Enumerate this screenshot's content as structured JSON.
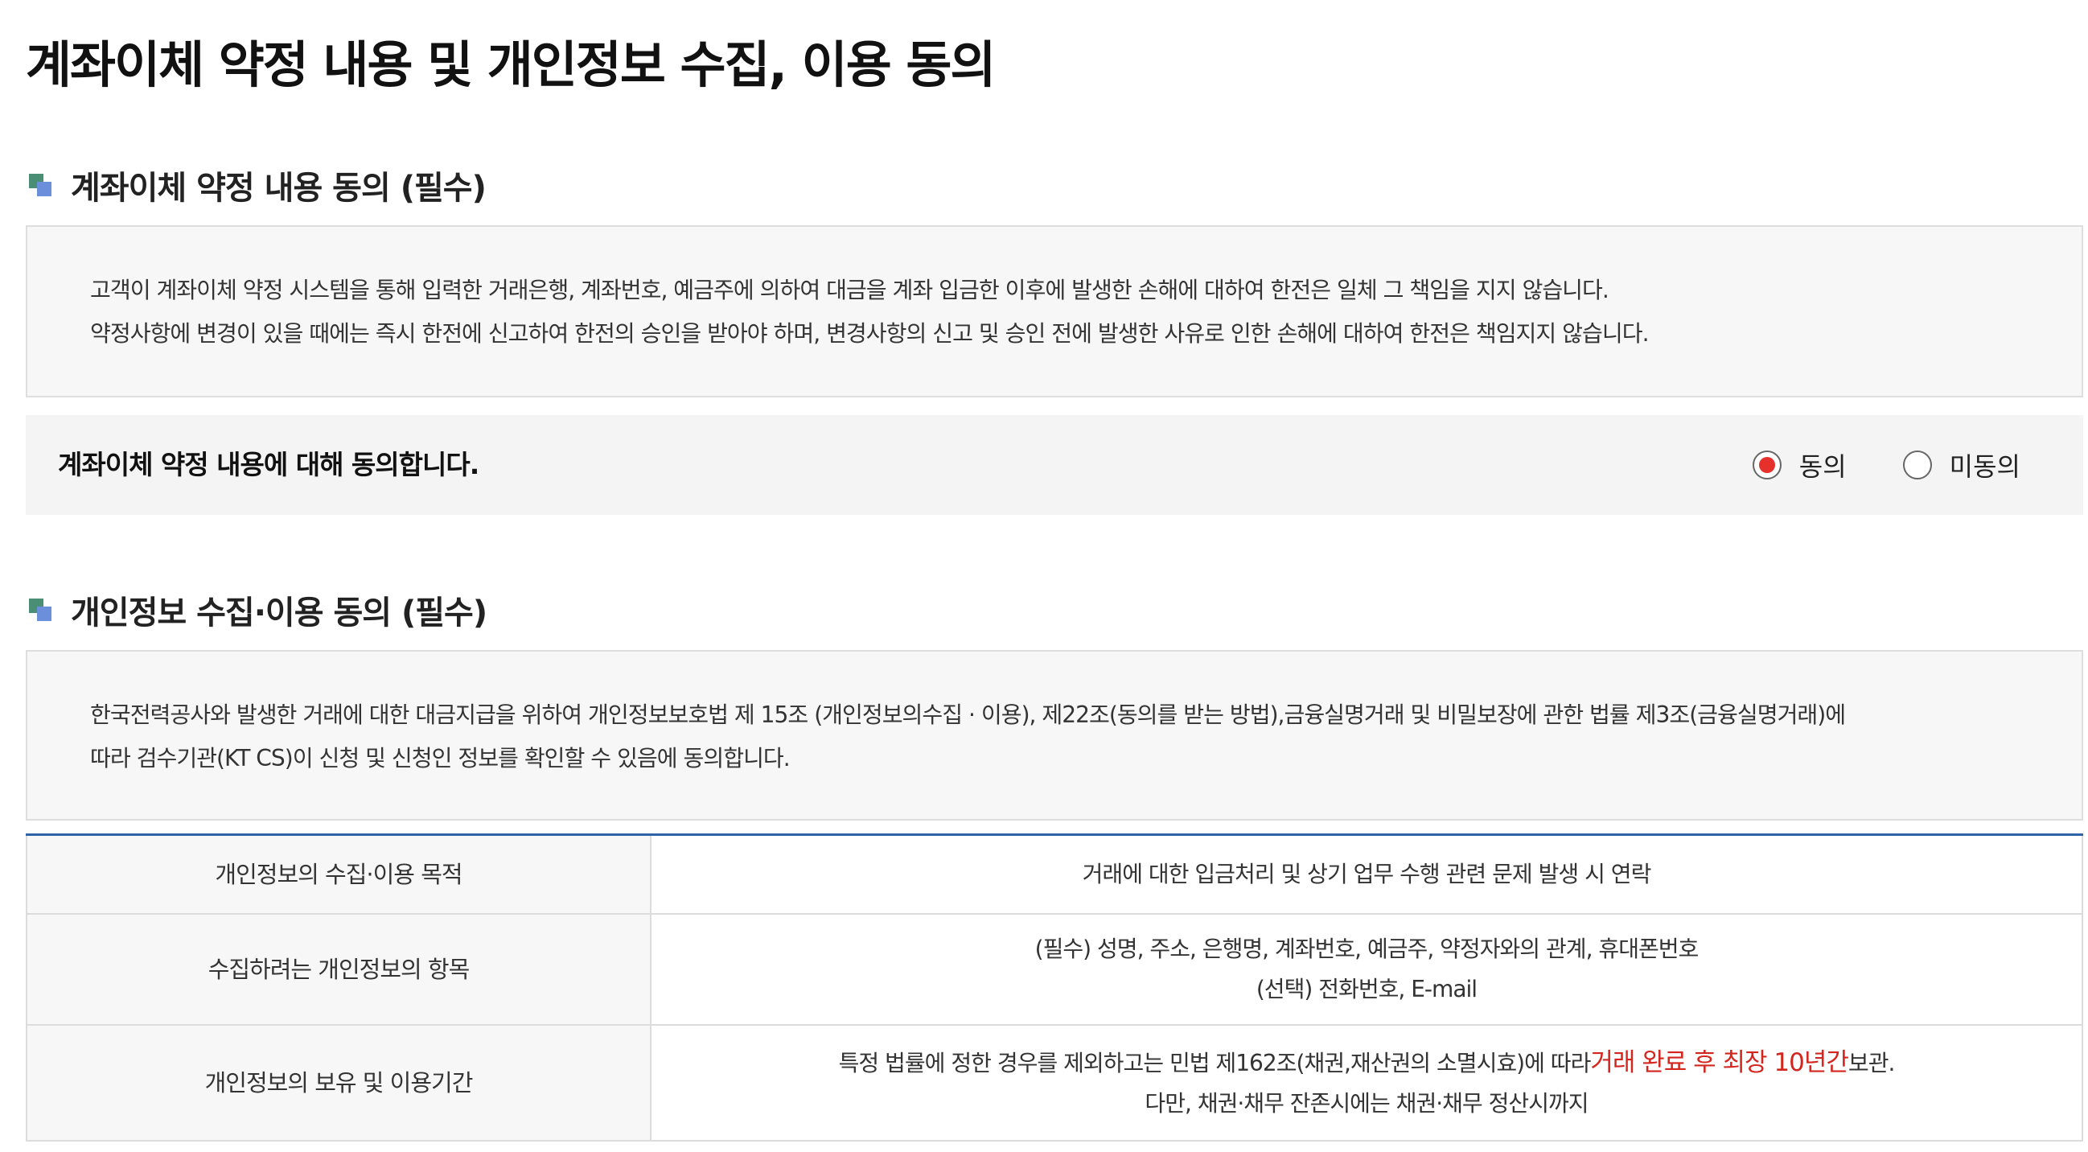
{
  "page_title": "계좌이체 약정 내용 및 개인정보 수집, 이용 동의",
  "section1": {
    "title": "계좌이체 약정 내용 동의 (필수)",
    "lines": [
      "고객이 계좌이체 약정 시스템을 통해 입력한 거래은행, 계좌번호, 예금주에 의하여 대금을 계좌 입금한 이후에 발생한 손해에 대하여 한전은 일체 그 책임을 지지 않습니다.",
      "약정사항에 변경이 있을 때에는 즉시 한전에 신고하여 한전의 승인을 받아야 하며, 변경사항의 신고 및 승인 전에 발생한 사유로 인한 손해에 대하여 한전은 책임지지 않습니다."
    ],
    "agree_question": "계좌이체 약정 내용에 대해 동의합니다.",
    "options": {
      "agree": "동의",
      "disagree": "미동의"
    },
    "selected": "agree"
  },
  "section2": {
    "title": "개인정보 수집·이용 동의 (필수)",
    "lines": [
      "한국전력공사와 발생한 거래에 대한 대금지급을 위하여 개인정보보호법 제 15조 (개인정보의수집 · 이용), 제22조(동의를 받는 방법),금융실명거래 및 비밀보장에 관한 법률 제3조(금융실명거래)에",
      "따라 검수기관(KT CS)이 신청 및 신청인 정보를 확인할 수 있음에 동의합니다."
    ],
    "table": {
      "rows": [
        {
          "header": "개인정보의 수집·이용 목적",
          "value_line1": "거래에 대한 입금처리 및 상기 업무 수행 관련 문제 발생 시 연락"
        },
        {
          "header": "수집하려는 개인정보의 항목",
          "value_line1": "(필수) 성명, 주소, 은행명, 계좌번호, 예금주, 약정자와의 관계, 휴대폰번호",
          "value_line2": "(선택) 전화번호, E-mail"
        },
        {
          "header": "개인정보의 보유 및 이용기간",
          "value_line1_prefix": "특정 법률에 정한 경우를 제외하고는 민법 제162조(채권,재산권의 소멸시효)에 따라",
          "value_line1_highlight": "거래 완료 후 최장 10년간",
          "value_line1_suffix": "보관.",
          "value_line2": "다만, 채권·채무 잔존시에는 채권·채무 정산시까지"
        }
      ]
    }
  },
  "colors": {
    "accent_red": "#e5302b",
    "highlight_red": "#d3261f",
    "table_top_border": "#2f63a8",
    "icon_green": "#4a8f75",
    "icon_blue": "#6c8fdb"
  }
}
